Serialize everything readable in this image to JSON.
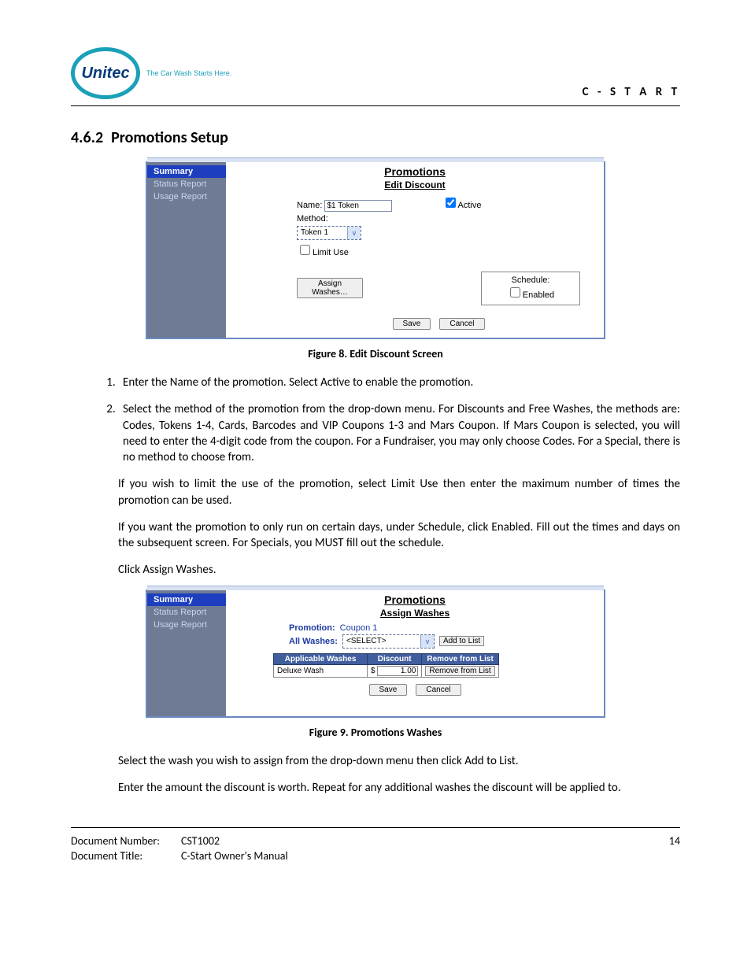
{
  "header": {
    "logo_text": "Unitec",
    "logo_tagline": "The Car Wash Starts Here.",
    "right": "C - S T A R T"
  },
  "section": {
    "number": "4.6.2",
    "title": "Promotions Setup"
  },
  "fig8": {
    "caption": "Figure 8. Edit Discount Screen",
    "sidebar": {
      "summary": "Summary",
      "status": "Status Report",
      "usage": "Usage Report"
    },
    "title": "Promotions",
    "subtitle": "Edit Discount",
    "name_label": "Name:",
    "name_value": "$1 Token",
    "active_label": "Active",
    "method_label": "Method:",
    "method_value": "Token 1",
    "limit_label": "Limit Use",
    "assign_btn": "Assign Washes…",
    "schedule_title": "Schedule:",
    "enabled_label": "Enabled",
    "save": "Save",
    "cancel": "Cancel"
  },
  "steps": {
    "s1": "Enter the Name of the promotion. Select Active to enable the promotion.",
    "s2a": "Select the method of the promotion from the drop-down menu. For Discounts and Free Washes, the methods are: Codes, Tokens 1-4, Cards, Barcodes and VIP Coupons 1-3 and Mars Coupon. If Mars Coupon is selected, you will need to enter the 4-digit code from the coupon. For a Fundraiser, you may only choose Codes. For a Special, there is no method to choose from.",
    "s2b": "If you wish to limit the use of the promotion, select Limit Use then enter the maximum number of times the promotion can be used.",
    "s2c": "If you want the promotion to only run on certain days, under Schedule, click Enabled. Fill out the times and days on the subsequent screen. For Specials, you MUST fill out the schedule.",
    "s2d": "Click Assign Washes."
  },
  "fig9": {
    "caption": "Figure 9. Promotions Washes",
    "sidebar": {
      "summary": "Summary",
      "status": "Status Report",
      "usage": "Usage Report"
    },
    "title": "Promotions",
    "subtitle": "Assign Washes",
    "promotion_label": "Promotion:",
    "promotion_value": "Coupon 1",
    "all_washes_label": "All Washes:",
    "select_placeholder": "<SELECT>",
    "add_btn": "Add to List",
    "col_washes": "Applicable Washes",
    "col_discount": "Discount",
    "col_remove": "Remove from List",
    "row_wash": "Deluxe Wash",
    "row_currency": "$",
    "row_value": "1.00",
    "row_remove": "Remove from List",
    "save": "Save",
    "cancel": "Cancel"
  },
  "post": {
    "p1": "Select the wash you wish to assign from the drop-down menu then click Add to List.",
    "p2": "Enter the amount the discount is worth. Repeat for any additional washes the discount will be applied to."
  },
  "footer": {
    "docnum_label": "Document Number:",
    "docnum_value": "CST1002",
    "title_label": "Document Title:",
    "title_value": "C-Start Owner's Manual",
    "page": "14"
  }
}
